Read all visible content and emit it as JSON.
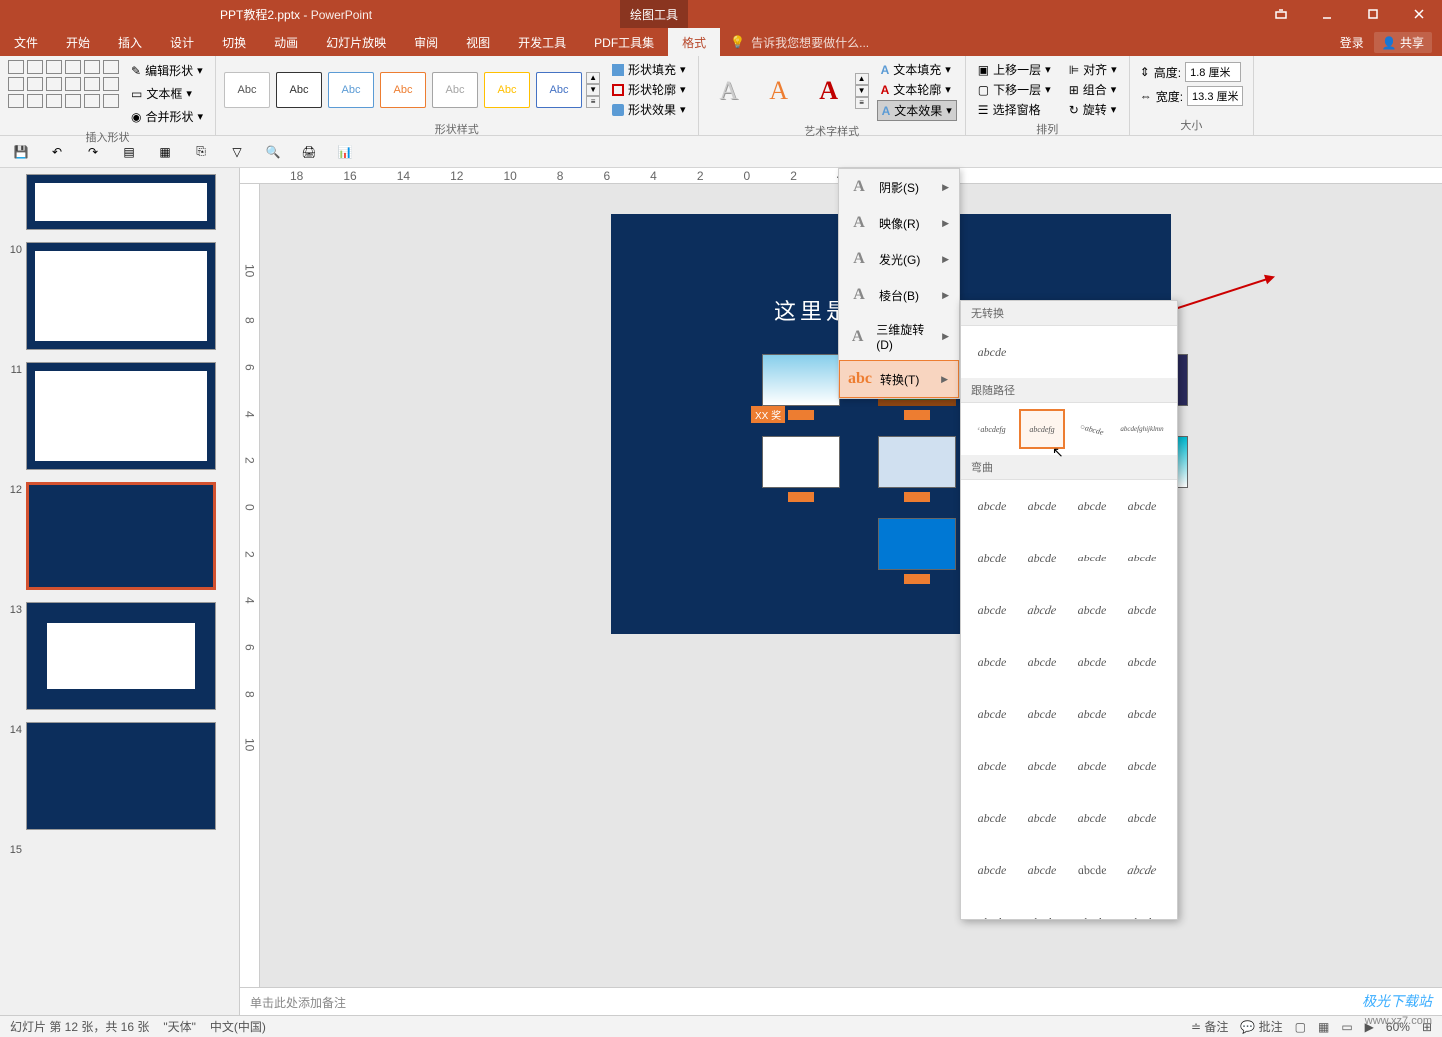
{
  "titlebar": {
    "filename": "PPT教程2.pptx",
    "app": "PowerPoint",
    "context_tab": "绘图工具"
  },
  "menu": {
    "file": "文件",
    "home": "开始",
    "insert": "插入",
    "design": "设计",
    "transitions": "切换",
    "animations": "动画",
    "slideshow": "幻灯片放映",
    "review": "审阅",
    "view": "视图",
    "developer": "开发工具",
    "pdf": "PDF工具集",
    "format": "格式",
    "tellme": "告诉我您想要做什么...",
    "login": "登录",
    "share": "共享"
  },
  "ribbon": {
    "insert_shapes": {
      "edit_shape": "编辑形状",
      "textbox": "文本框",
      "merge": "合并形状",
      "label": "插入形状"
    },
    "shape_styles": {
      "abc": "Abc",
      "fill": "形状填充",
      "outline": "形状轮廓",
      "effects": "形状效果",
      "label": "形状样式"
    },
    "wordart": {
      "a": "A",
      "text_fill": "文本填充",
      "text_outline": "文本轮廓",
      "text_effects": "文本效果",
      "label": "艺术字样式"
    },
    "arrange": {
      "bring_forward": "上移一层",
      "send_backward": "下移一层",
      "selection_pane": "选择窗格",
      "align": "对齐",
      "group": "组合",
      "rotate": "旋转",
      "label": "排列"
    },
    "size": {
      "height_label": "高度:",
      "height": "1.8 厘米",
      "width_label": "宽度:",
      "width": "13.3 厘米",
      "label": "大小"
    }
  },
  "text_effects_menu": {
    "shadow": "阴影(S)",
    "reflection": "映像(R)",
    "glow": "发光(G)",
    "bevel": "棱台(B)",
    "rotation_3d": "三维旋转(D)",
    "transform": "转换(T)"
  },
  "transform_panel": {
    "no_transform": "无转换",
    "sample": "abcde",
    "follow_path": "跟随路径",
    "warp": "弯曲"
  },
  "slide": {
    "title": "这里是举例文字内容",
    "xx_label": "XX 奖"
  },
  "thumbnails": {
    "n10": "10",
    "n11": "11",
    "n12": "12",
    "n13": "13",
    "n14": "14",
    "n15": "15"
  },
  "notes": {
    "placeholder": "单击此处添加备注"
  },
  "statusbar": {
    "slide_info": "幻灯片 第 12 张，共 16 张",
    "theme": "\"天体\"",
    "lang": "中文(中国)",
    "notes": "备注",
    "comments": "批注",
    "zoom": "60%"
  },
  "watermark": {
    "name": "极光下载站",
    "url": "www.xz7.com"
  }
}
